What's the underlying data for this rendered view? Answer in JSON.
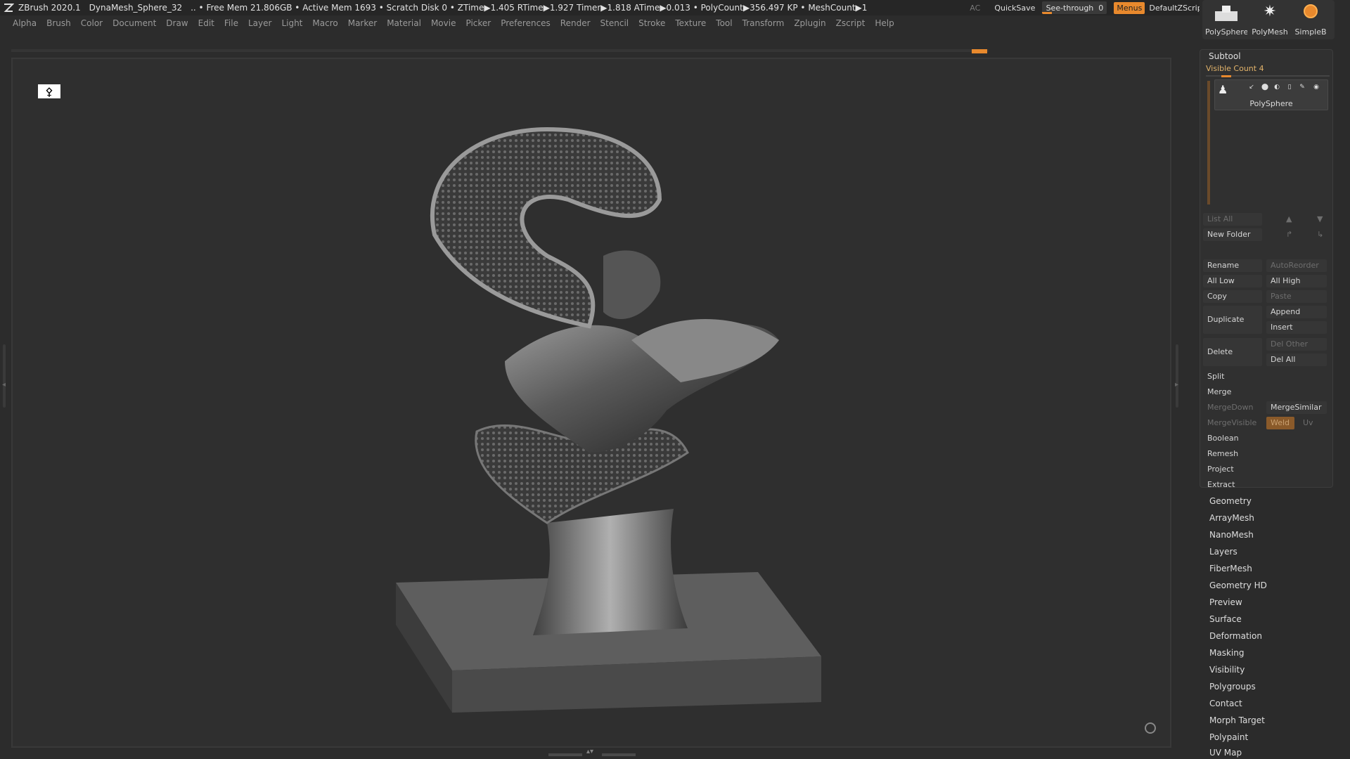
{
  "titlebar": {
    "app": "ZBrush 2020.1",
    "file": "DynaMesh_Sphere_32",
    "stats": ".. • Free Mem 21.806GB • Active Mem 1693 • Scratch Disk 0 • ZTime▶1.405 RTime▶1.927 Timer▶1.818 ATime▶0.013 • PolyCount▶356.497 KP • MeshCount▶1",
    "ac": "AC",
    "quicksave": "QuickSave",
    "seethrough_label": "See-through",
    "seethrough_value": "0",
    "menus": "Menus",
    "script": "DefaultZScript"
  },
  "menubar": [
    "Alpha",
    "Brush",
    "Color",
    "Document",
    "Draw",
    "Edit",
    "File",
    "Layer",
    "Light",
    "Macro",
    "Marker",
    "Material",
    "Movie",
    "Picker",
    "Preferences",
    "Render",
    "Stencil",
    "Stroke",
    "Texture",
    "Tool",
    "Transform",
    "Zplugin",
    "Zscript",
    "Help"
  ],
  "thumbs": [
    {
      "label": "PolySphere",
      "icon": "polysphere-icon"
    },
    {
      "label": "PolyMesh",
      "icon": "star-icon"
    },
    {
      "label": "SimpleB",
      "icon": "simplebrush-icon"
    }
  ],
  "subtool": {
    "header": "Subtool",
    "visible_count": "Visible Count 4",
    "item_name": "PolySphere",
    "list_all": "List All",
    "new_folder": "New Folder",
    "rename": "Rename",
    "auto_reorder": "AutoReorder",
    "all_low": "All Low",
    "all_high": "All High",
    "copy": "Copy",
    "paste": "Paste",
    "duplicate": "Duplicate",
    "append": "Append",
    "insert": "Insert",
    "delete": "Delete",
    "del_other": "Del Other",
    "del_all": "Del All",
    "split": "Split",
    "merge": "Merge",
    "merge_down": "MergeDown",
    "merge_similar": "MergeSimilar",
    "merge_visible": "MergeVisible",
    "weld": "Weld",
    "uv": "Uv",
    "boolean": "Boolean",
    "remesh": "Remesh",
    "project": "Project",
    "extract": "Extract"
  },
  "sections": [
    "Geometry",
    "ArrayMesh",
    "NanoMesh",
    "Layers",
    "FiberMesh",
    "Geometry HD",
    "Preview",
    "Surface",
    "Deformation",
    "Masking",
    "Visibility",
    "Polygroups",
    "Contact",
    "Morph Target",
    "Polypaint",
    "UV Map"
  ],
  "colors": {
    "accent": "#e8892d",
    "background": "#2c2c2c",
    "panel": "#303030"
  }
}
